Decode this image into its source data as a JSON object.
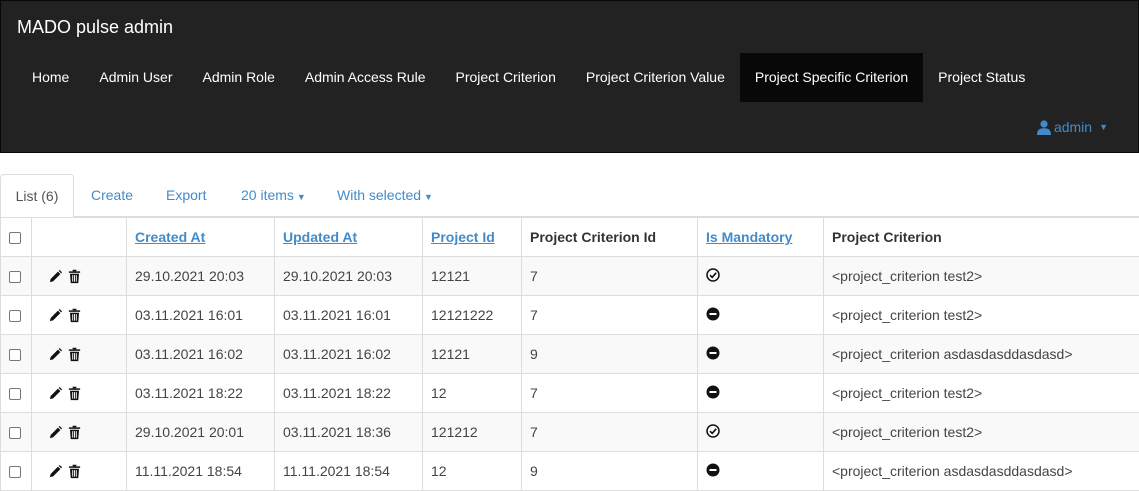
{
  "app": {
    "title": "MADO pulse admin"
  },
  "nav": {
    "items": [
      {
        "label": "Home"
      },
      {
        "label": "Admin User"
      },
      {
        "label": "Admin Role"
      },
      {
        "label": "Admin Access Rule"
      },
      {
        "label": "Project Criterion"
      },
      {
        "label": "Project Criterion Value"
      },
      {
        "label": "Project Specific Criterion",
        "active": true
      },
      {
        "label": "Project Status"
      }
    ],
    "user": {
      "label": "admin",
      "icon": "user-icon"
    }
  },
  "tabs": {
    "list": "List (6)",
    "create": "Create",
    "export": "Export",
    "per_page": "20 items",
    "with_selected": "With selected"
  },
  "table": {
    "headers": {
      "created_at": "Created At",
      "updated_at": "Updated At",
      "project_id": "Project Id",
      "project_criterion_id": "Project Criterion Id",
      "is_mandatory": "Is Mandatory",
      "project_criterion": "Project Criterion"
    },
    "rows": [
      {
        "created_at": "29.10.2021 20:03",
        "updated_at": "29.10.2021 20:03",
        "project_id": "12121",
        "project_criterion_id": "7",
        "is_mandatory": "check",
        "project_criterion": "<project_criterion test2>"
      },
      {
        "created_at": "03.11.2021 16:01",
        "updated_at": "03.11.2021 16:01",
        "project_id": "12121222",
        "project_criterion_id": "7",
        "is_mandatory": "minus",
        "project_criterion": "<project_criterion test2>"
      },
      {
        "created_at": "03.11.2021 16:02",
        "updated_at": "03.11.2021 16:02",
        "project_id": "12121",
        "project_criterion_id": "9",
        "is_mandatory": "minus",
        "project_criterion": "<project_criterion asdasdasddasdasd>"
      },
      {
        "created_at": "03.11.2021 18:22",
        "updated_at": "03.11.2021 18:22",
        "project_id": "12",
        "project_criterion_id": "7",
        "is_mandatory": "minus",
        "project_criterion": "<project_criterion test2>"
      },
      {
        "created_at": "29.10.2021 20:01",
        "updated_at": "03.11.2021 18:36",
        "project_id": "121212",
        "project_criterion_id": "7",
        "is_mandatory": "check",
        "project_criterion": "<project_criterion test2>"
      },
      {
        "created_at": "11.11.2021 18:54",
        "updated_at": "11.11.2021 18:54",
        "project_id": "12",
        "project_criterion_id": "9",
        "is_mandatory": "minus",
        "project_criterion": "<project_criterion asdasdasddasdasd>"
      }
    ]
  },
  "colors": {
    "navbar": "#222222",
    "link": "#428bca",
    "active_nav": "#080808"
  }
}
